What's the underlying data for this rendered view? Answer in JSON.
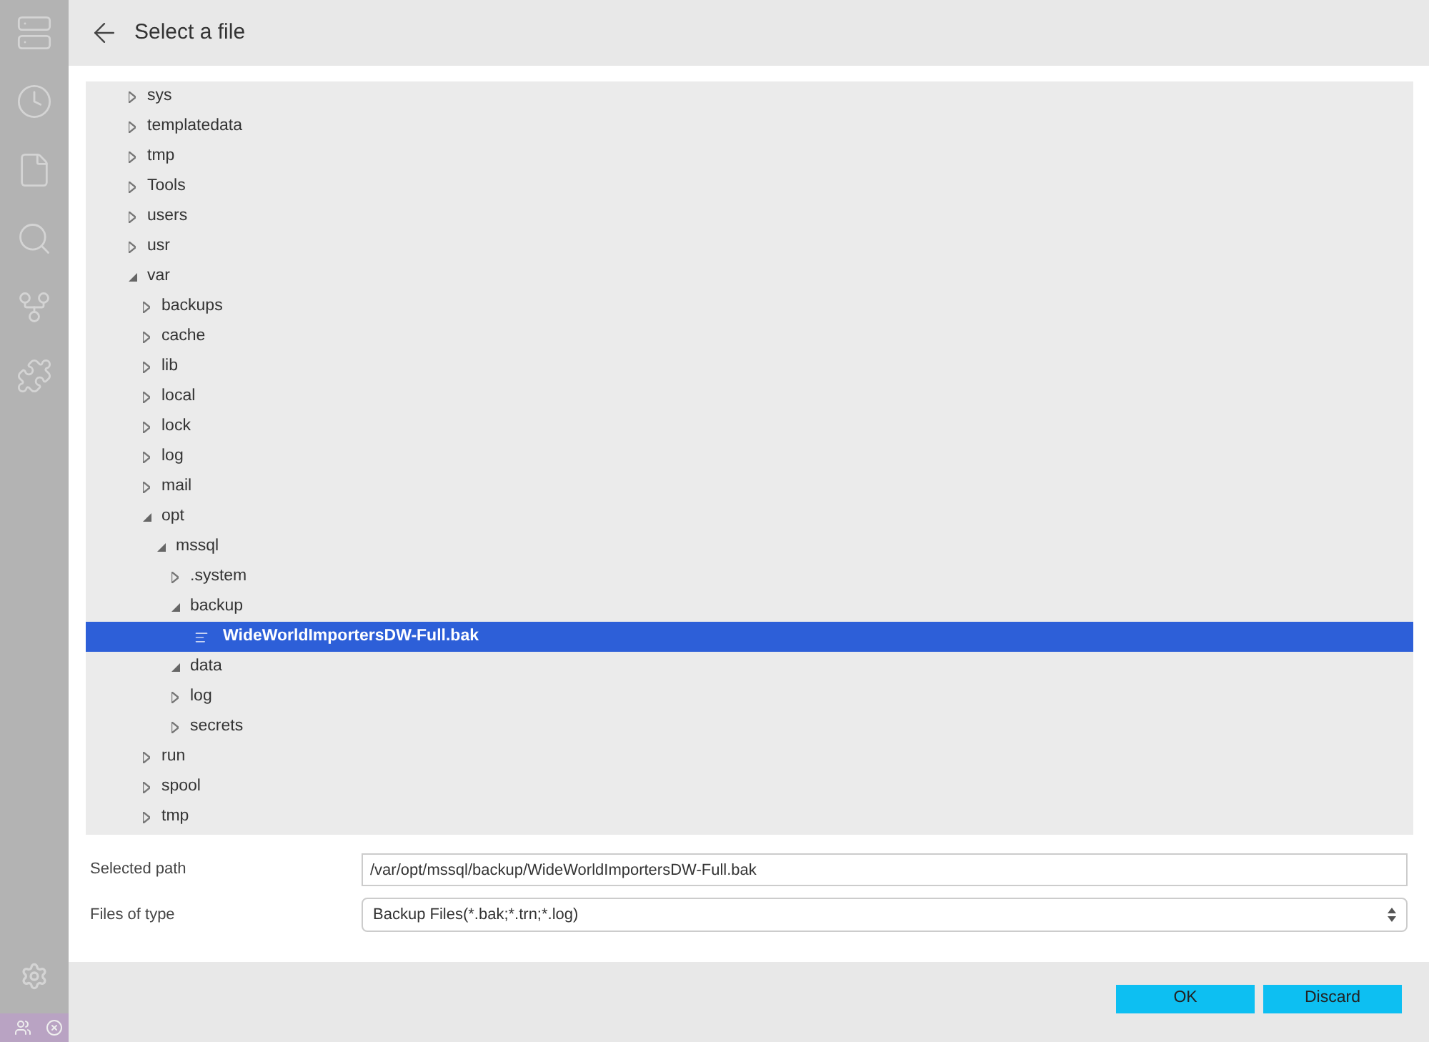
{
  "header": {
    "title": "Select a file"
  },
  "tree": [
    {
      "label": "sys",
      "kind": "folder",
      "expanded": false,
      "selected": false
    },
    {
      "label": "templatedata",
      "kind": "folder",
      "expanded": false,
      "selected": false
    },
    {
      "label": "tmp",
      "kind": "folder",
      "expanded": false,
      "selected": false
    },
    {
      "label": "Tools",
      "kind": "folder",
      "expanded": false,
      "selected": false
    },
    {
      "label": "users",
      "kind": "folder",
      "expanded": false,
      "selected": false
    },
    {
      "label": "usr",
      "kind": "folder",
      "expanded": false,
      "selected": false
    },
    {
      "label": "var",
      "kind": "folder",
      "expanded": true,
      "selected": false,
      "children": [
        {
          "label": "backups",
          "kind": "folder",
          "expanded": false,
          "selected": false
        },
        {
          "label": "cache",
          "kind": "folder",
          "expanded": false,
          "selected": false
        },
        {
          "label": "lib",
          "kind": "folder",
          "expanded": false,
          "selected": false
        },
        {
          "label": "local",
          "kind": "folder",
          "expanded": false,
          "selected": false
        },
        {
          "label": "lock",
          "kind": "folder",
          "expanded": false,
          "selected": false
        },
        {
          "label": "log",
          "kind": "folder",
          "expanded": false,
          "selected": false
        },
        {
          "label": "mail",
          "kind": "folder",
          "expanded": false,
          "selected": false
        },
        {
          "label": "opt",
          "kind": "folder",
          "expanded": true,
          "selected": false,
          "children": [
            {
              "label": "mssql",
              "kind": "folder",
              "expanded": true,
              "selected": false,
              "children": [
                {
                  "label": ".system",
                  "kind": "folder",
                  "expanded": false,
                  "selected": false
                },
                {
                  "label": "backup",
                  "kind": "folder",
                  "expanded": true,
                  "selected": false,
                  "children": [
                    {
                      "label": "WideWorldImportersDW-Full.bak",
                      "kind": "file",
                      "selected": true
                    }
                  ]
                },
                {
                  "label": "data",
                  "kind": "folder",
                  "expanded": true,
                  "selected": false
                },
                {
                  "label": "log",
                  "kind": "folder",
                  "expanded": false,
                  "selected": false
                },
                {
                  "label": "secrets",
                  "kind": "folder",
                  "expanded": false,
                  "selected": false
                }
              ]
            }
          ]
        },
        {
          "label": "run",
          "kind": "folder",
          "expanded": false,
          "selected": false
        },
        {
          "label": "spool",
          "kind": "folder",
          "expanded": false,
          "selected": false
        },
        {
          "label": "tmp",
          "kind": "folder",
          "expanded": false,
          "selected": false
        }
      ]
    }
  ],
  "form": {
    "selected_path": {
      "label": "Selected path",
      "value": "/var/opt/mssql/backup/WideWorldImportersDW-Full.bak"
    },
    "files_of_type": {
      "label": "Files of type",
      "value": "Backup Files(*.bak;*.trn;*.log)"
    }
  },
  "buttons": [
    "OK",
    "Discard"
  ]
}
